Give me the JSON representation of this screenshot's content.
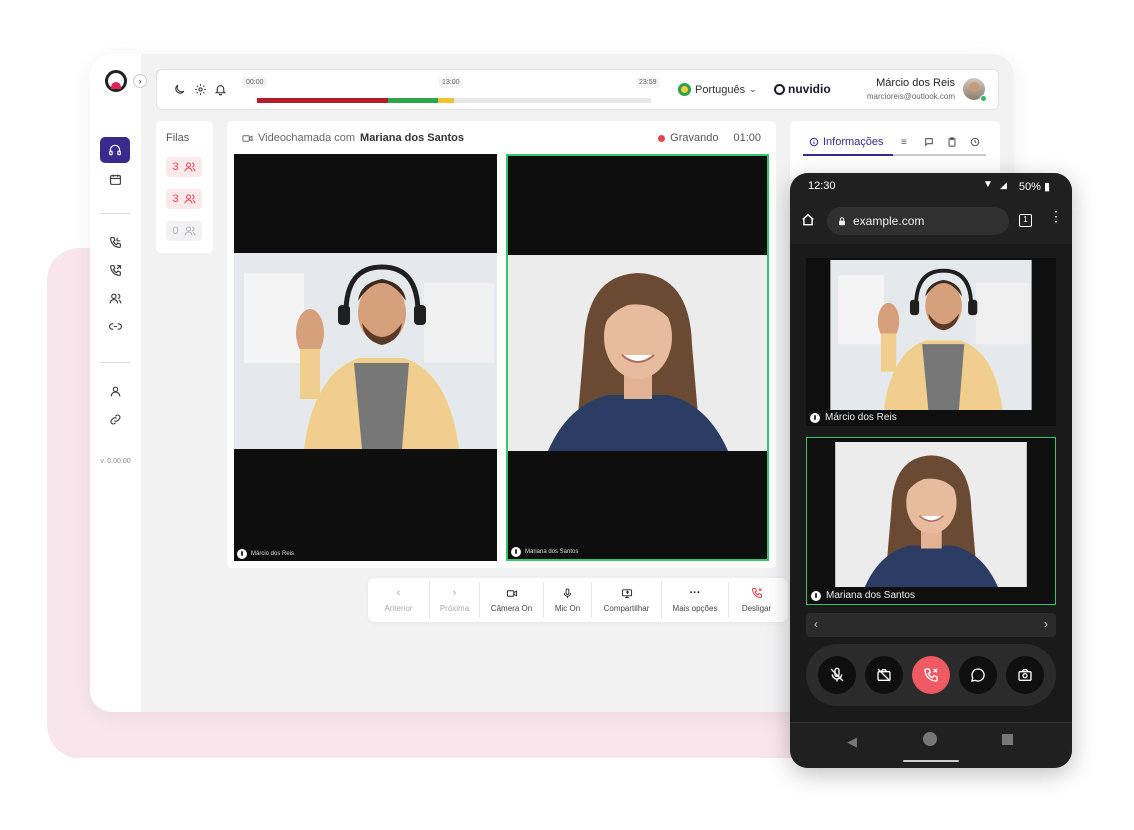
{
  "sidebar": {
    "version": "v. 0.00.00",
    "icons": [
      "headset-icon",
      "calendar-icon",
      "phone-incoming-icon",
      "phone-outgoing-icon",
      "users-icon",
      "link-icon",
      "user-icon",
      "chain-icon"
    ]
  },
  "topbar": {
    "timeline_start": "00:00",
    "timeline_current": "13:00",
    "timeline_end": "23:59",
    "language": "Português",
    "brand": "nuvidio",
    "user_name": "Márcio dos Reis",
    "user_email": "marcioreis@outlook.com",
    "timeline_progress": 0.5,
    "colors": {
      "red": "#b21d2b",
      "green": "#2ea44f",
      "yellow": "#f2c232"
    }
  },
  "queues": {
    "title": "Filas",
    "items": [
      {
        "count": "3",
        "state": "hot"
      },
      {
        "count": "3",
        "state": "hot"
      },
      {
        "count": "0",
        "state": "cold"
      }
    ]
  },
  "call": {
    "title_prefix": "Videochamada com",
    "title_name": "Mariana dos Santos",
    "recording_label": "Gravando",
    "recording_time": "01:00",
    "tiles": [
      {
        "label": "Márcio dos Reis"
      },
      {
        "label": "Mariana dos Santos"
      }
    ]
  },
  "controls": [
    {
      "label": "Anterior",
      "glyph": "‹",
      "icon": "chevron-left-icon"
    },
    {
      "label": "Próxima",
      "glyph": "›",
      "icon": "chevron-right-icon"
    },
    {
      "label": "Câmera On",
      "glyph": "▭",
      "icon": "camera-icon"
    },
    {
      "label": "Mic On",
      "glyph": "🎙",
      "icon": "microphone-icon"
    },
    {
      "label": "Compartilhar",
      "glyph": "⧉",
      "icon": "screen-share-icon"
    },
    {
      "label": "Mais opções",
      "glyph": "···",
      "icon": "more-icon"
    },
    {
      "label": "Desligar",
      "glyph": "✆",
      "icon": "hangup-icon"
    }
  ],
  "info": {
    "tab_label": "Informações"
  },
  "phone": {
    "time": "12:30",
    "battery": "50%",
    "url": "example.com",
    "tab_count": "1",
    "tiles": [
      {
        "label": "Márcio dos Reis"
      },
      {
        "label": "Mariana dos Santos"
      }
    ]
  }
}
